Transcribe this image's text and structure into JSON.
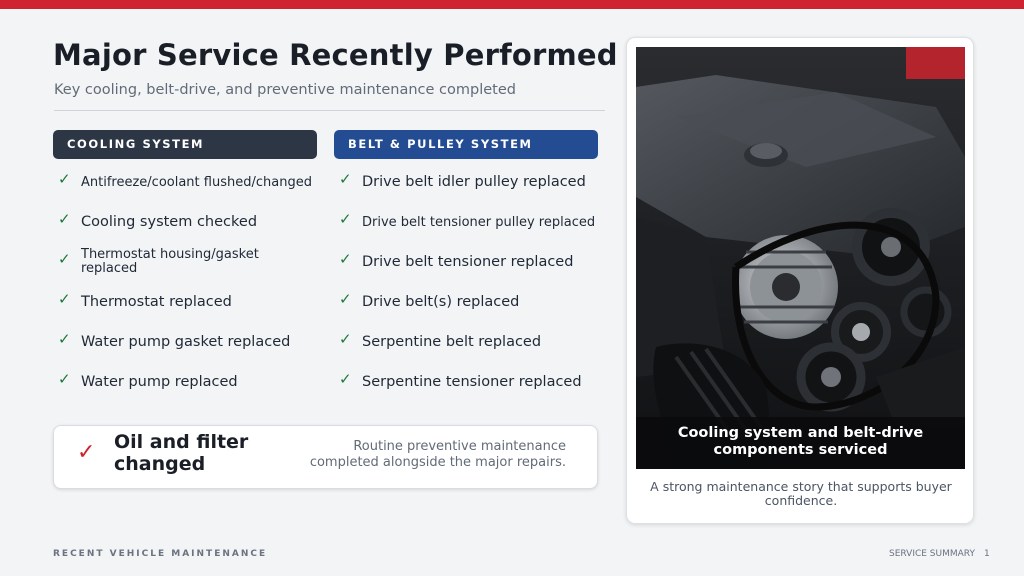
{
  "slide": {
    "title": "Major Service Recently Performed",
    "subtitle": "Key cooling, belt-drive, and preventive maintenance completed"
  },
  "cooling": {
    "header": "COOLING SYSTEM",
    "items": [
      {
        "label": "Antifreeze/coolant flushed/changed"
      },
      {
        "label": "Cooling system checked"
      },
      {
        "label": "Thermostat housing/gasket replaced"
      },
      {
        "label": "Thermostat replaced"
      },
      {
        "label": "Water pump gasket replaced"
      },
      {
        "label": "Water pump replaced"
      }
    ]
  },
  "belt": {
    "header": "BELT & PULLEY SYSTEM",
    "items": [
      {
        "label": "Drive belt idler pulley replaced"
      },
      {
        "label": "Drive belt tensioner pulley replaced"
      },
      {
        "label": "Drive belt tensioner replaced"
      },
      {
        "label": "Drive belt(s) replaced"
      },
      {
        "label": "Serpentine belt replaced"
      },
      {
        "label": "Serpentine tensioner replaced"
      }
    ]
  },
  "check_glyph": "✓",
  "oil": {
    "check": "✓",
    "title": "Oil and filter changed",
    "description": "Routine preventive maintenance completed alongside the major repairs."
  },
  "photo": {
    "caption": "Cooling system and belt-drive components serviced",
    "note": "A strong maintenance story that supports buyer confidence."
  },
  "footer": {
    "left": "RECENT VEHICLE MAINTENANCE",
    "right": "SERVICE SUMMARY",
    "page": "1"
  },
  "colors": {
    "accent_red": "#cf2331",
    "cooling_header": "#2c3645",
    "belt_header": "#244c92",
    "check_green": "#1e7a3c"
  }
}
